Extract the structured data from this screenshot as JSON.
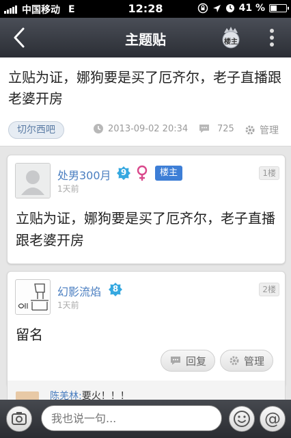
{
  "status_bar": {
    "carrier": "中国移动",
    "network": "E",
    "time": "12:28",
    "battery": "41 %",
    "battery_level": 0.41
  },
  "nav": {
    "title": "主题贴",
    "owner_button_label": "楼主"
  },
  "topic": {
    "title": "立贴为证，娜狗要是买了厄齐尔，老子直播跟老婆开房",
    "forum": "切尔西吧",
    "date": "2013-09-02 20:34",
    "comment_count": "725",
    "manage_label": "管理"
  },
  "posts": [
    {
      "username": "处男300月",
      "level": "9",
      "gender_icon": "female-icon",
      "owner_tag": "楼主",
      "time": "1天前",
      "floor": "1楼",
      "content": "立贴为证，娜狗要是买了厄齐尔，老子直播跟老婆开房"
    },
    {
      "username": "幻影流焰",
      "level": "8",
      "time": "1天前",
      "floor": "2楼",
      "content": "留名",
      "reply_label": "回复",
      "manage_label": "管理"
    }
  ],
  "sub_reply": {
    "author": "陈羌林:",
    "text": "要火！！！"
  },
  "composer": {
    "placeholder": "我也说一句..."
  },
  "colors": {
    "accent": "#4a7ec0",
    "owner_tag": "#3d7ed6",
    "level_badge": "#35a8e0",
    "female": "#d9488b"
  }
}
